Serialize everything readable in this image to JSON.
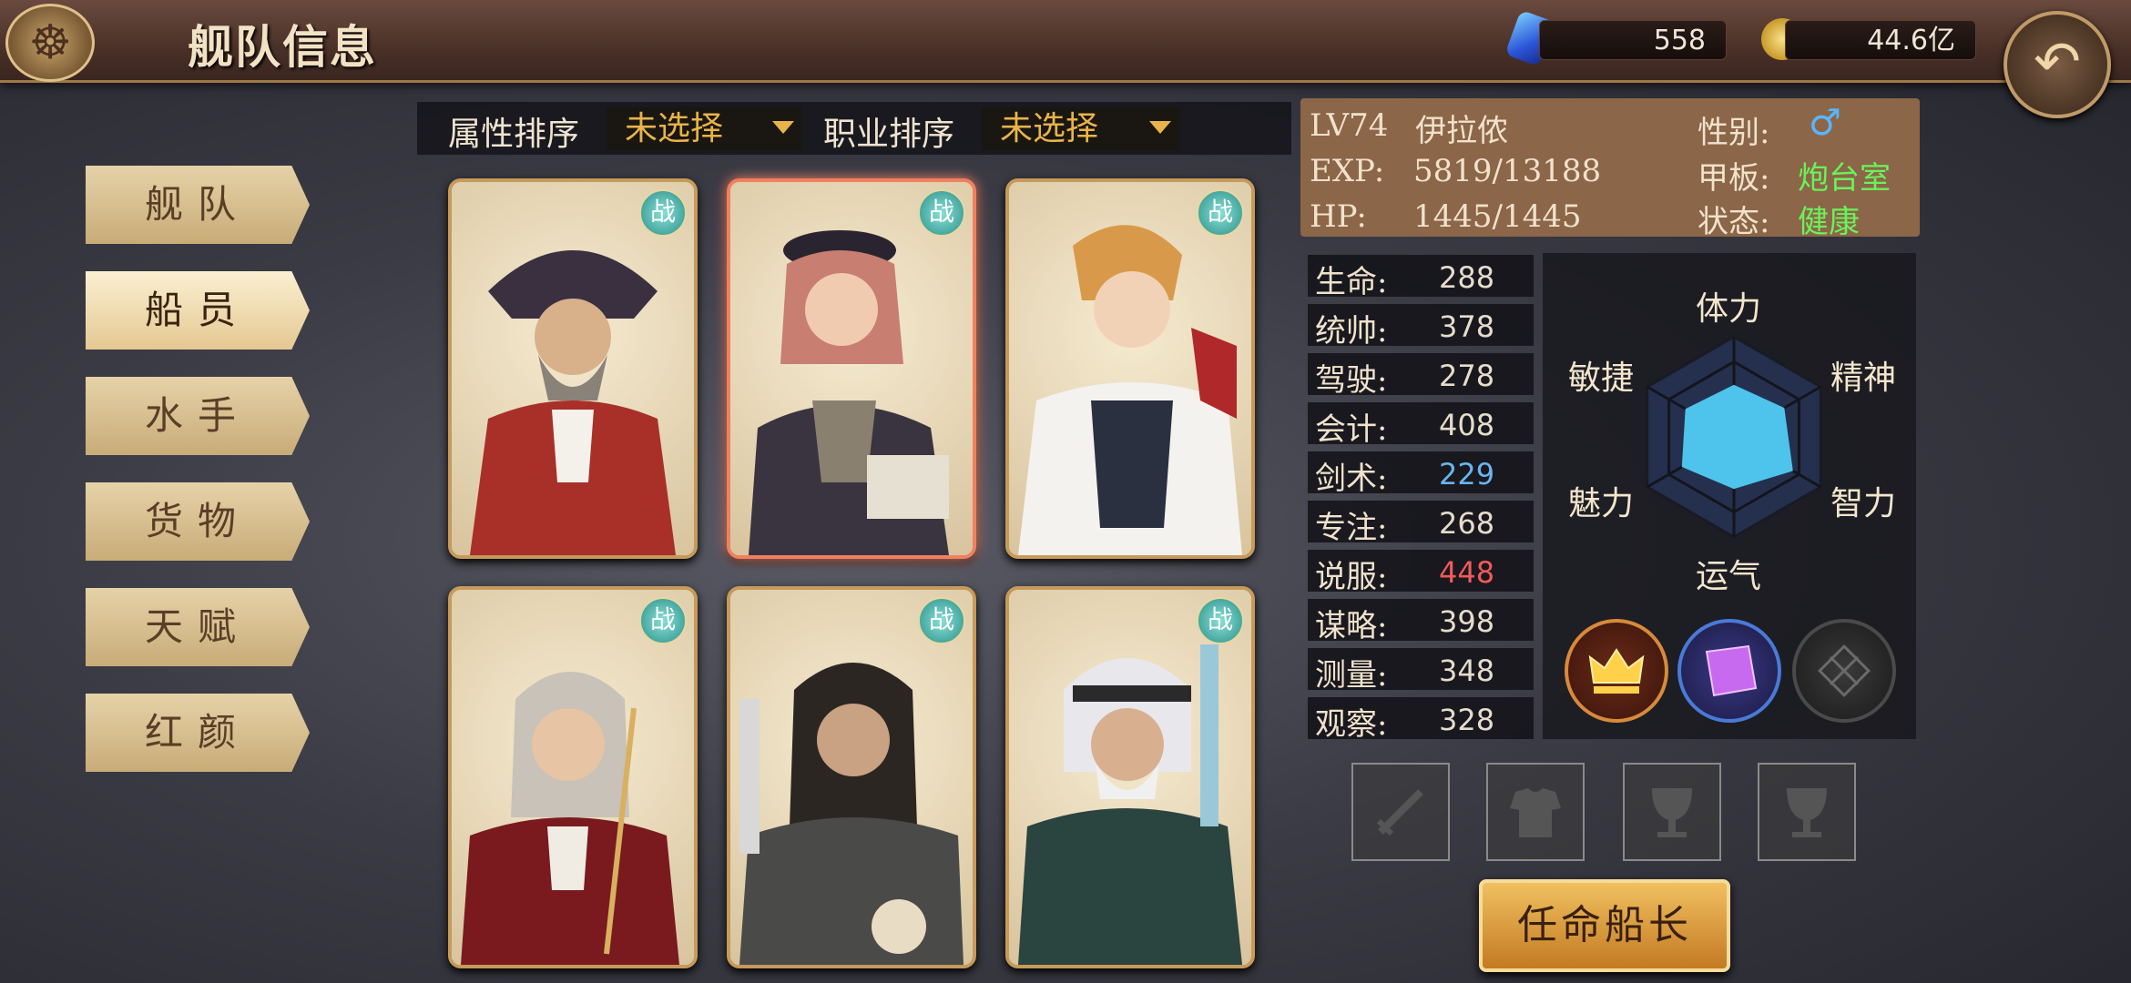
{
  "header": {
    "title": "舰队信息",
    "gems": "558",
    "gold": "44.6亿",
    "logo_icon": "ship-wheel-icon",
    "back_icon": "back-arrow-icon"
  },
  "nav": {
    "items": [
      {
        "label": "舰队"
      },
      {
        "label": "船员"
      },
      {
        "label": "水手"
      },
      {
        "label": "货物"
      },
      {
        "label": "天赋"
      },
      {
        "label": "红颜"
      }
    ],
    "active_index": 1
  },
  "filters": {
    "attr_label": "属性排序",
    "attr_value": "未选择",
    "job_label": "职业排序",
    "job_value": "未选择"
  },
  "cards": {
    "badge": "战",
    "selected_index": 1,
    "count": 6
  },
  "character": {
    "level": "LV74",
    "name": "伊拉侬",
    "exp_label": "EXP:",
    "exp": "5819/13188",
    "hp_label": "HP:",
    "hp": "1445/1445",
    "gender_label": "性别:",
    "gender_icon": "male-icon",
    "deck_label": "甲板:",
    "deck": "炮台室",
    "status_label": "状态:",
    "status": "健康"
  },
  "stats": [
    {
      "label": "生命:",
      "value": "288",
      "color": "#e6dccb"
    },
    {
      "label": "统帅:",
      "value": "378",
      "color": "#e6dccb"
    },
    {
      "label": "驾驶:",
      "value": "278",
      "color": "#e6dccb"
    },
    {
      "label": "会计:",
      "value": "408",
      "color": "#e6dccb"
    },
    {
      "label": "剑术:",
      "value": "229",
      "color": "#6ab4f0"
    },
    {
      "label": "专注:",
      "value": "268",
      "color": "#e6dccb"
    },
    {
      "label": "说服:",
      "value": "448",
      "color": "#f05a5a"
    },
    {
      "label": "谋略:",
      "value": "398",
      "color": "#e6dccb"
    },
    {
      "label": "测量:",
      "value": "348",
      "color": "#e6dccb"
    },
    {
      "label": "观察:",
      "value": "328",
      "color": "#e6dccb"
    }
  ],
  "radar": {
    "labels": {
      "top": "体力",
      "top_right": "精神",
      "bottom_right": "智力",
      "bottom": "运气",
      "bottom_left": "魅力",
      "top_left": "敏捷"
    },
    "fill_color": "#4ec4ec"
  },
  "skills": [
    "crown-skill-icon",
    "book-skill-icon",
    "locked-skill-icon"
  ],
  "equipment": [
    "sword-slot-icon",
    "armor-slot-icon",
    "cup-slot-icon",
    "cup-slot-icon"
  ],
  "appoint_button": "任命船长"
}
